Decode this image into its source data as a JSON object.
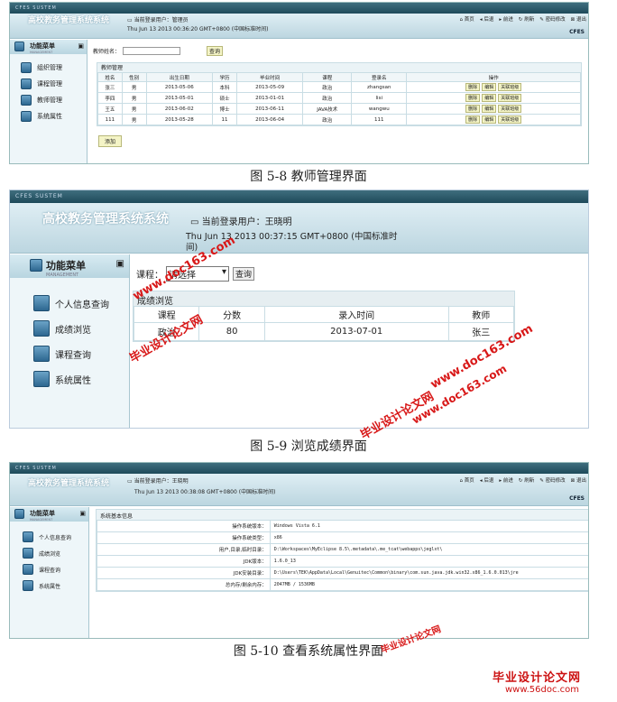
{
  "s1": {
    "topbar": "CFES SUSTEM",
    "sysname": "高校教务管理系统系统",
    "user_label": "当前登录用户：管理员",
    "date": "Thu Jun 13 2013 00:36:20 GMT+0800 (中国标准时间)",
    "nav": [
      "首页",
      "后退",
      "前进",
      "刷新",
      "密码修改",
      "退出"
    ],
    "brand": "CFES",
    "menu_title": "功能菜单",
    "menu_sub": "MANAGEMENT",
    "menu": [
      "组织管理",
      "课程管理",
      "教师管理",
      "系统属性"
    ],
    "search_label": "教师姓名：",
    "search_button": "查询",
    "section": "教师管理",
    "headers": [
      "姓名",
      "性别",
      "出生日期",
      "学历",
      "毕业时间",
      "课程",
      "登录名",
      "操作"
    ],
    "rows": [
      [
        "张三",
        "男",
        "2013-05-06",
        "本科",
        "2013-05-09",
        "政治",
        "zhangsan"
      ],
      [
        "李四",
        "男",
        "2013-05-01",
        "硕士",
        "2013-01-01",
        "政治",
        "lisi"
      ],
      [
        "王五",
        "男",
        "2013-06-02",
        "博士",
        "2013-06-11",
        "JAVA技术",
        "wangwu"
      ],
      [
        "111",
        "男",
        "2013-05-28",
        "11",
        "2013-06-04",
        "政治",
        "111"
      ]
    ],
    "actions": [
      "删除",
      "编辑",
      "关联班级"
    ],
    "add_button": "添加"
  },
  "cap1": "图 5-8 教师管理界面",
  "s2": {
    "topbar": "CFES SUSTEM",
    "sysname": "高校教务管理系统系统",
    "user_label": "当前登录用户：王晓明",
    "date": "Thu Jun 13 2013 00:37:15 GMT+0800 (中国标准时间)",
    "menu_title": "功能菜单",
    "menu_sub": "MANAGEMENT",
    "menu": [
      "个人信息查询",
      "成绩浏览",
      "课程查询",
      "系统属性"
    ],
    "course_label": "课程：",
    "course_select": "请选择",
    "query_button": "查询",
    "section": "成绩浏览",
    "headers": [
      "课程",
      "分数",
      "录入时间",
      "教师"
    ],
    "rows": [
      [
        "政治",
        "80",
        "2013-07-01",
        "张三"
      ]
    ]
  },
  "cap2": "图 5-9 浏览成绩界面",
  "s3": {
    "topbar": "CFES SUSTEM",
    "sysname": "高校教务管理系统系统",
    "user_label": "当前登录用户：王晓明",
    "date": "Thu Jun 13 2013 00:38:08 GMT+0800 (中国标准时间)",
    "nav": [
      "首页",
      "后退",
      "前进",
      "刷新",
      "密码修改",
      "退出"
    ],
    "brand": "CFES",
    "menu_title": "功能菜单",
    "menu_sub": "MANAGEMENT",
    "menu": [
      "个人信息查询",
      "成绩浏览",
      "课程查询",
      "系统属性"
    ],
    "section": "系统基本信息",
    "props": [
      [
        "操作系统版本：",
        "Windows Vista 6.1"
      ],
      [
        "操作系统类型：",
        "x86"
      ],
      [
        "用户,目录,临时目录：",
        "D:\\Workspaces\\MyEclipse 8.5\\.metadata\\.me_tcat\\webapps\\jeglxt\\"
      ],
      [
        "JDK版本：",
        "1.6.0_13"
      ],
      [
        "JDK安装目录：",
        "D:\\Users\\TEK\\AppData\\Local\\Genuitec\\Common\\binary\\com.sun.java.jdk.win32.x86_1.6.0.013\\jre"
      ],
      [
        "总内存/剩余内存：",
        "2047MB / 1536MB"
      ]
    ]
  },
  "cap3": "图 5-10 查看系统属性界面",
  "watermarks": [
    "毕业设计论文网",
    "www.doc163.com",
    "毕业设计论文网",
    "www.doc163.com",
    "毕业设计论文网",
    "www.doc163.com"
  ],
  "footer_logo": "毕业设计论文网",
  "footer_url": "www.56doc.com",
  "colors": {
    "accent": "#1e4a5a",
    "watermark": "#d81818",
    "button": "#f4f4c6"
  }
}
